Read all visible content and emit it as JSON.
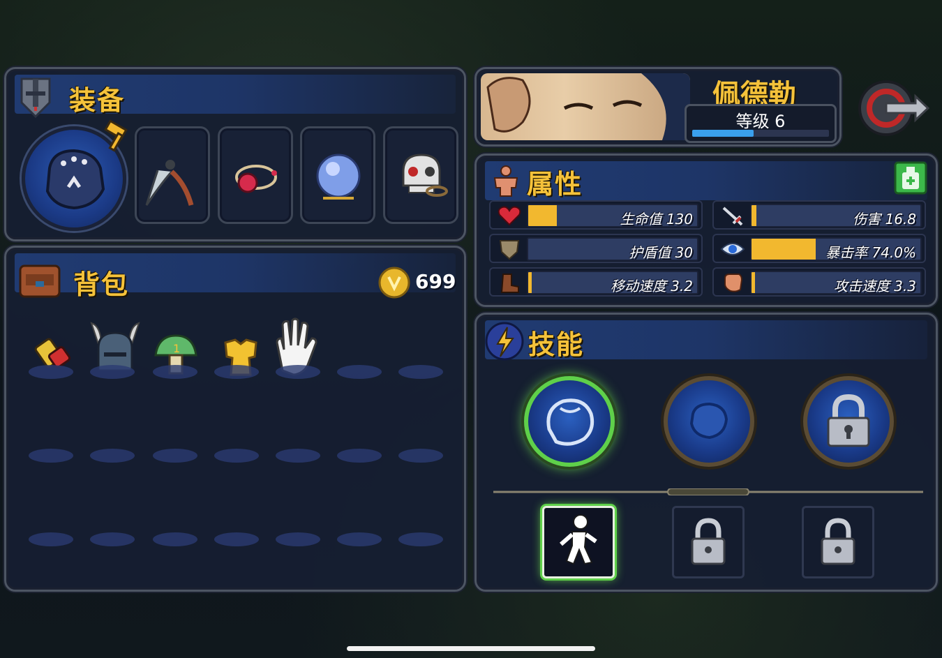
{
  "equipment": {
    "title": "装备"
  },
  "backpack": {
    "title": "背包",
    "coins": "699",
    "items": [
      {
        "icon": "potion-icon"
      },
      {
        "icon": "viking-helmet-icon"
      },
      {
        "icon": "green-mushroom-icon"
      },
      {
        "icon": "golden-chestplate-icon"
      },
      {
        "icon": "white-glove-icon"
      }
    ]
  },
  "hero": {
    "name": "佩德勒",
    "level_label": "等级 6",
    "xp_fraction": 0.45
  },
  "attributes": {
    "title": "属性",
    "stats": [
      {
        "label": "生命值 130",
        "fill": 0.17,
        "icon": "heart-icon"
      },
      {
        "label": "伤害 16.8",
        "fill": 0.03,
        "icon": "sword-icon"
      },
      {
        "label": "护盾值 30",
        "fill": 0.0,
        "icon": "shield-icon"
      },
      {
        "label": "暴击率 74.0%",
        "fill": 0.38,
        "icon": "eye-icon"
      },
      {
        "label": "移动速度 3.2",
        "fill": 0.02,
        "icon": "boot-icon"
      },
      {
        "label": "攻击速度 3.3",
        "fill": 0.02,
        "icon": "fist-icon"
      }
    ]
  },
  "skills": {
    "title": "技能"
  },
  "colors": {
    "title_gold": "#f5c23a",
    "stat_fill": "#f2b82f",
    "skill_highlight": "#6fe04a"
  }
}
